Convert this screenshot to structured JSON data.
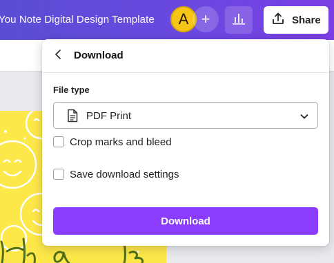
{
  "header": {
    "doc_title": "You Note Digital Design Template",
    "avatar_initial": "A",
    "add_symbol": "+",
    "share_label": "Share"
  },
  "panel": {
    "title": "Download",
    "back_icon": "chevron-left-icon",
    "file_type_label": "File type",
    "file_type_value": "PDF Print",
    "options": [
      {
        "label": "Crop marks and bleed",
        "checked": false
      },
      {
        "label": "Save download settings",
        "checked": false
      }
    ],
    "download_label": "Download"
  },
  "icons": {
    "insights": "bar-chart-icon",
    "share": "upload-icon",
    "file": "document-icon",
    "dropdown": "chevron-down-icon"
  },
  "colors": {
    "header_start": "#5a4ed4",
    "header_end": "#7b3fe4",
    "accent": "#8b3dff",
    "avatar": "#f5c518",
    "design_yellow": "#fde84a",
    "script_green": "#4f6f1a"
  }
}
